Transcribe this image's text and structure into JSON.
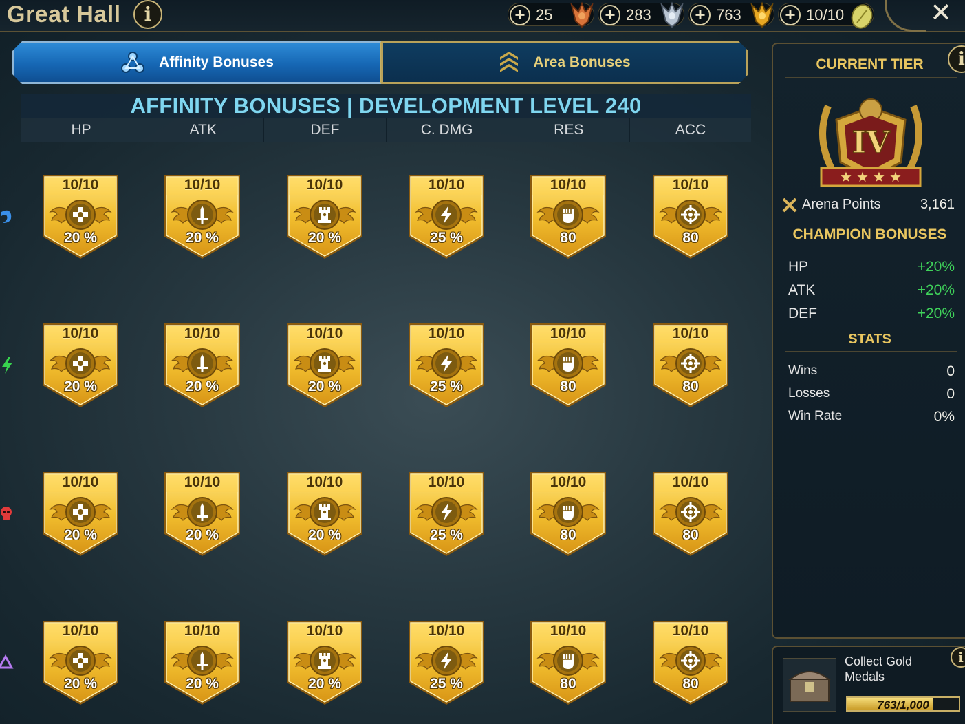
{
  "header": {
    "title": "Great Hall",
    "info_label": "i",
    "close_label": "✕",
    "resources": [
      {
        "name": "bronze-medal",
        "value": "25",
        "color": "#d9743a"
      },
      {
        "name": "silver-medal",
        "value": "283",
        "color": "#b8c4d2"
      },
      {
        "name": "gold-medal",
        "value": "763",
        "color": "#e8a823"
      },
      {
        "name": "arena-token",
        "value": "10/10",
        "color": "#d7d36a"
      }
    ]
  },
  "tabs": {
    "affinity": "Affinity Bonuses",
    "area": "Area Bonuses"
  },
  "grid": {
    "heading": "AFFINITY BONUSES | DEVELOPMENT LEVEL 240",
    "columns": [
      "HP",
      "ATK",
      "DEF",
      "C. DMG",
      "RES",
      "ACC"
    ],
    "row_affinities": [
      {
        "name": "magic",
        "color": "#3a8fe8"
      },
      {
        "name": "force",
        "color": "#37d24e"
      },
      {
        "name": "spirit",
        "color": "#e23a3a"
      },
      {
        "name": "void",
        "color": "#b57af0"
      }
    ],
    "rows": [
      {
        "cells": [
          {
            "level": "10/10",
            "value": "20 %",
            "icon": "cross-icon"
          },
          {
            "level": "10/10",
            "value": "20 %",
            "icon": "sword-icon"
          },
          {
            "level": "10/10",
            "value": "20 %",
            "icon": "tower-icon"
          },
          {
            "level": "10/10",
            "value": "25 %",
            "icon": "bolt-icon"
          },
          {
            "level": "10/10",
            "value": "80",
            "icon": "fist-icon"
          },
          {
            "level": "10/10",
            "value": "80",
            "icon": "target-icon"
          }
        ]
      },
      {
        "cells": [
          {
            "level": "10/10",
            "value": "20 %",
            "icon": "cross-icon"
          },
          {
            "level": "10/10",
            "value": "20 %",
            "icon": "sword-icon"
          },
          {
            "level": "10/10",
            "value": "20 %",
            "icon": "tower-icon"
          },
          {
            "level": "10/10",
            "value": "25 %",
            "icon": "bolt-icon"
          },
          {
            "level": "10/10",
            "value": "80",
            "icon": "fist-icon"
          },
          {
            "level": "10/10",
            "value": "80",
            "icon": "target-icon"
          }
        ]
      },
      {
        "cells": [
          {
            "level": "10/10",
            "value": "20 %",
            "icon": "cross-icon"
          },
          {
            "level": "10/10",
            "value": "20 %",
            "icon": "sword-icon"
          },
          {
            "level": "10/10",
            "value": "20 %",
            "icon": "tower-icon"
          },
          {
            "level": "10/10",
            "value": "25 %",
            "icon": "bolt-icon"
          },
          {
            "level": "10/10",
            "value": "80",
            "icon": "fist-icon"
          },
          {
            "level": "10/10",
            "value": "80",
            "icon": "target-icon"
          }
        ]
      },
      {
        "cells": [
          {
            "level": "10/10",
            "value": "20 %",
            "icon": "cross-icon"
          },
          {
            "level": "10/10",
            "value": "20 %",
            "icon": "sword-icon"
          },
          {
            "level": "10/10",
            "value": "20 %",
            "icon": "tower-icon"
          },
          {
            "level": "10/10",
            "value": "25 %",
            "icon": "bolt-icon"
          },
          {
            "level": "10/10",
            "value": "80",
            "icon": "fist-icon"
          },
          {
            "level": "10/10",
            "value": "80",
            "icon": "target-icon"
          }
        ]
      }
    ]
  },
  "side": {
    "current_tier_label": "CURRENT TIER",
    "tier_numeral": "IV",
    "tier_stars": 4,
    "arena_points_label": "Arena Points",
    "arena_points_value": "3,161",
    "champion_bonuses_label": "CHAMPION BONUSES",
    "bonuses": [
      {
        "stat": "HP",
        "value": "+20%"
      },
      {
        "stat": "ATK",
        "value": "+20%"
      },
      {
        "stat": "DEF",
        "value": "+20%"
      }
    ],
    "stats_label": "STATS",
    "stats": [
      {
        "label": "Wins",
        "value": "0"
      },
      {
        "label": "Losses",
        "value": "0"
      },
      {
        "label": "Win Rate",
        "value": "0%"
      }
    ],
    "bonus_color": "#3fd25a"
  },
  "medal_panel": {
    "label_line1": "Collect Gold",
    "label_line2": "Medals",
    "progress_text": "763/1,000",
    "progress_fraction": 0.763
  }
}
